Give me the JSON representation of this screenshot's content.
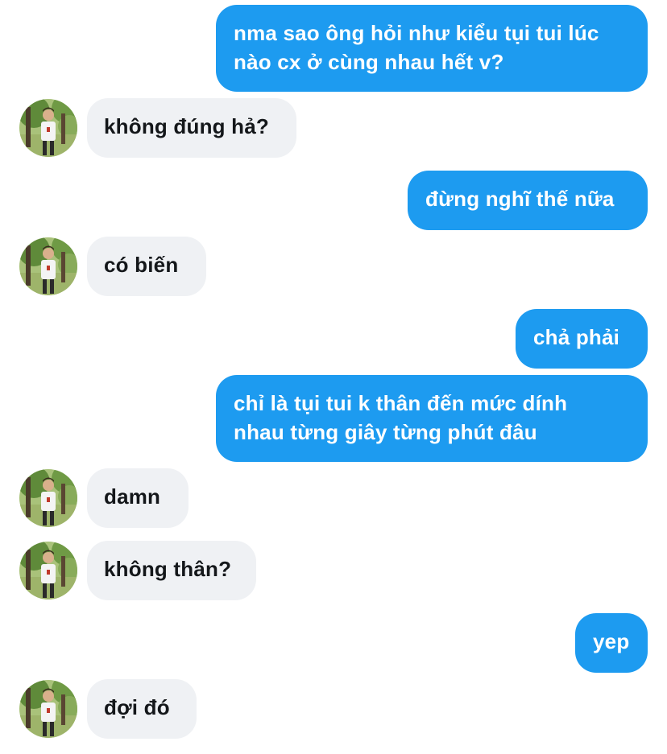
{
  "messages": [
    {
      "side": "out",
      "text_lines": [
        "nma sao ông hỏi như kiểu tụi tui lúc",
        "nào cx ở cùng nhau hết v?"
      ]
    },
    {
      "side": "in",
      "text": "không đúng hả?"
    },
    {
      "side": "out",
      "text": "đừng nghĩ thế nữa"
    },
    {
      "side": "in",
      "text": "có biến"
    },
    {
      "side": "out",
      "text": "chả phải"
    },
    {
      "side": "out",
      "text_lines": [
        "chỉ là tụi tui k thân đến mức dính",
        "nhau từng giây từng phút đâu"
      ]
    },
    {
      "side": "in",
      "text": "damn"
    },
    {
      "side": "in",
      "text": "không thân?"
    },
    {
      "side": "out",
      "text": "yep"
    },
    {
      "side": "in",
      "text": "đợi đó"
    }
  ],
  "colors": {
    "outgoing_bubble": "#1d9bf0",
    "incoming_bubble": "#eff1f4",
    "outgoing_text": "#ffffff",
    "incoming_text": "#14171a"
  },
  "avatar": {
    "icon": "contact-avatar-photo"
  }
}
